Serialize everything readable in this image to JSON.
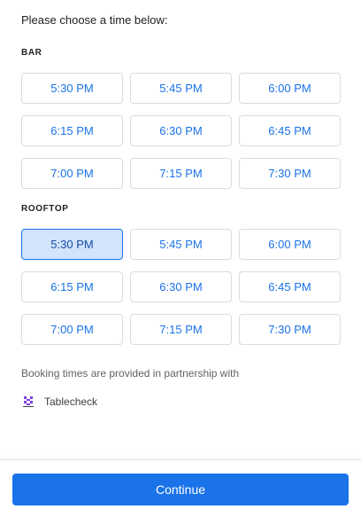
{
  "prompt": "Please choose a time below:",
  "sections": [
    {
      "label": "BAR",
      "times": [
        "5:30 PM",
        "5:45 PM",
        "6:00 PM",
        "6:15 PM",
        "6:30 PM",
        "6:45 PM",
        "7:00 PM",
        "7:15 PM",
        "7:30 PM"
      ]
    },
    {
      "label": "ROOFTOP",
      "times": [
        "5:30 PM",
        "5:45 PM",
        "6:00 PM",
        "6:15 PM",
        "6:30 PM",
        "6:45 PM",
        "7:00 PM",
        "7:15 PM",
        "7:30 PM"
      ],
      "selected": "5:30 PM"
    }
  ],
  "partner": {
    "text": "Booking times are provided in partnership with",
    "name": "Tablecheck",
    "icon": "tablecheck-logo-icon"
  },
  "continue_label": "Continue",
  "colors": {
    "accent": "#1a73e8",
    "selected_bg": "#d2e3fc"
  }
}
